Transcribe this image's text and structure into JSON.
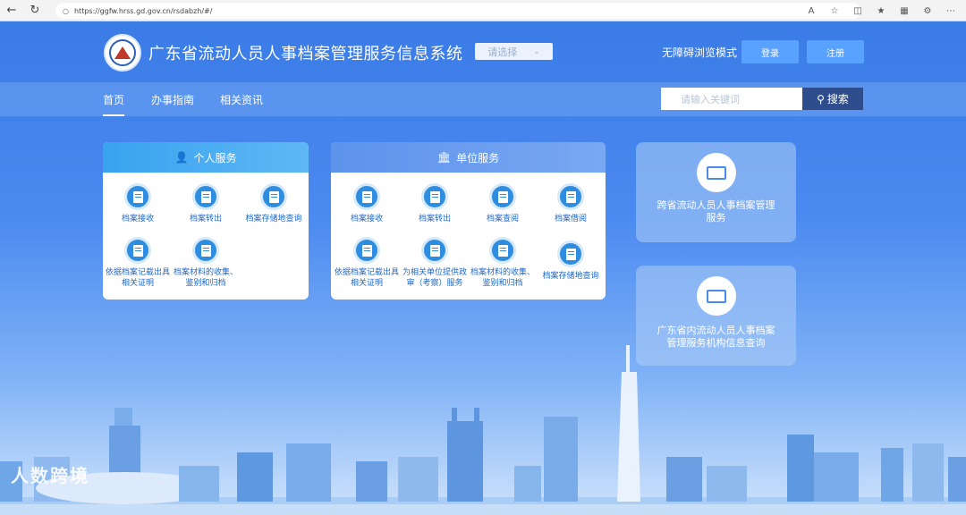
{
  "browser": {
    "url": "https://ggfw.hrss.gd.gov.cn/rsdabzh/#/"
  },
  "header": {
    "title": "广东省流动人员人事档案管理服务信息系统",
    "select_placeholder": "请选择",
    "accessibility_mode": "无障碍浏览模式",
    "login": "登录",
    "register": "注册"
  },
  "nav": {
    "items": [
      "首页",
      "办事指南",
      "相关资讯"
    ],
    "search_placeholder": "请输入关键词",
    "search_button": "搜索"
  },
  "personal": {
    "title": "个人服务",
    "items": [
      {
        "label": "档案接收"
      },
      {
        "label": "档案转出"
      },
      {
        "label": "档案存储地查询"
      },
      {
        "label": "依据档案记载出具相关证明"
      },
      {
        "label": "档案材料的收集、鉴别和归档"
      }
    ]
  },
  "unit": {
    "title": "单位服务",
    "items": [
      {
        "label": "档案接收"
      },
      {
        "label": "档案转出"
      },
      {
        "label": "档案查阅"
      },
      {
        "label": "档案借阅"
      },
      {
        "label": "依据档案记载出具相关证明"
      },
      {
        "label": "为相关单位提供政审（考察）服务"
      },
      {
        "label": "档案材料的收集、鉴别和归档"
      },
      {
        "label": "档案存储地查询"
      }
    ]
  },
  "side": {
    "cross_province": "跨省流动人员人事档案管理服务",
    "institution_query": "广东省内流动人员人事档案管理服务机构信息查询"
  },
  "watermark": "人数跨境"
}
